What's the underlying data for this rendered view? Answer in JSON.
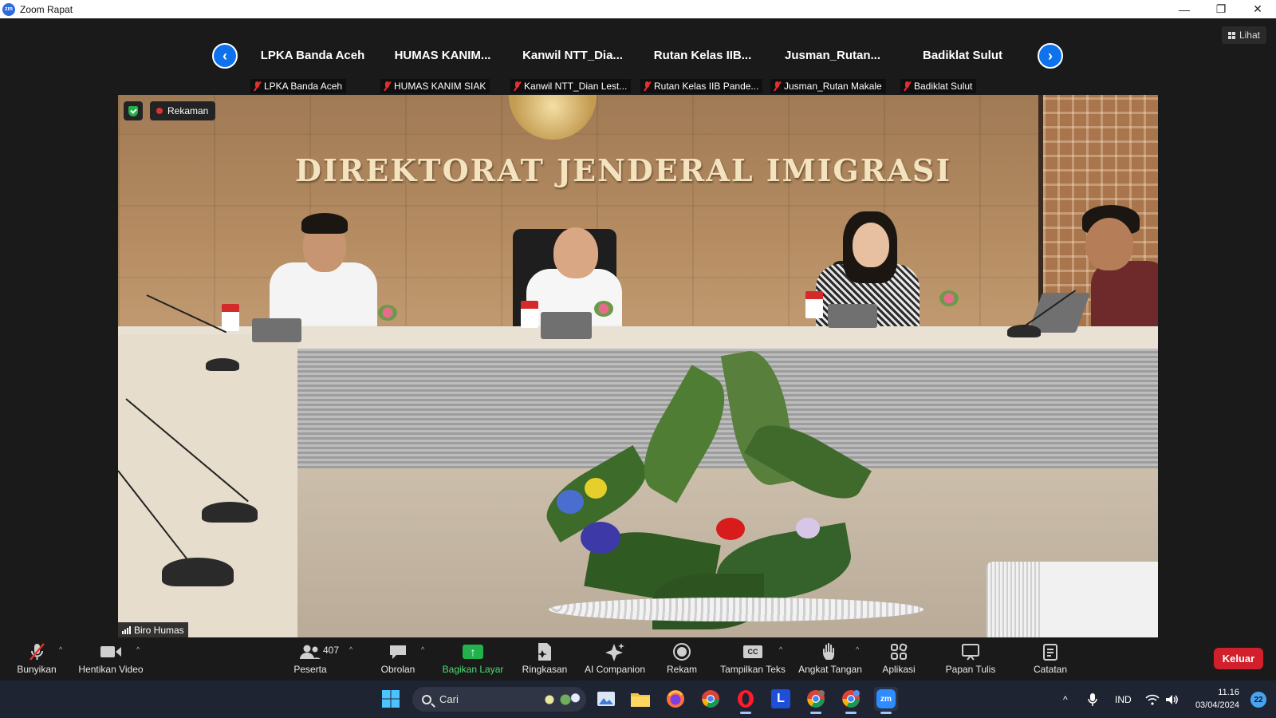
{
  "window": {
    "title": "Zoom Rapat",
    "app_icon": "zm"
  },
  "view_button": {
    "label": "Lihat"
  },
  "participants_strip": [
    {
      "display": "LPKA Banda Aceh",
      "name": "LPKA Banda Aceh"
    },
    {
      "display": "HUMAS  KANIM...",
      "name": "HUMAS KANIM SIAK"
    },
    {
      "display": "Kanwil  NTT_Dia...",
      "name": "Kanwil NTT_Dian Lest..."
    },
    {
      "display": "Rutan Kelas IIB...",
      "name": "Rutan Kelas IIB Pande..."
    },
    {
      "display": "Jusman_Rutan...",
      "name": "Jusman_Rutan Makale"
    },
    {
      "display": "Badiklat Sulut",
      "name": "Badiklat Sulut"
    }
  ],
  "main_video": {
    "recording_label": "Rekaman",
    "speaker_name": "Biro Humas",
    "wall_sign": "DIREKTORAT JENDERAL IMIGRASI"
  },
  "toolbar": {
    "mute": "Bunyikan",
    "video": "Hentikan Video",
    "participants": "Peserta",
    "participants_count": "407",
    "chat": "Obrolan",
    "share": "Bagikan Layar",
    "summary": "Ringkasan",
    "ai": "AI Companion",
    "record": "Rekam",
    "captions": "Tampilkan Teks",
    "captions_icon_text": "CC",
    "raise_hand": "Angkat Tangan",
    "apps": "Aplikasi",
    "whiteboard": "Papan Tulis",
    "notes": "Catatan",
    "leave": "Keluar"
  },
  "taskbar": {
    "search_placeholder": "Cari",
    "lang": "IND",
    "time": "11.16",
    "date": "03/04/2024",
    "notifications": "22",
    "launcher_l": "L",
    "zoom_app": "zm"
  },
  "colors": {
    "accent": "#0e72ed",
    "share_green": "#22b14c",
    "leave_red": "#d11f2b",
    "taskbar": "#1f2433"
  }
}
